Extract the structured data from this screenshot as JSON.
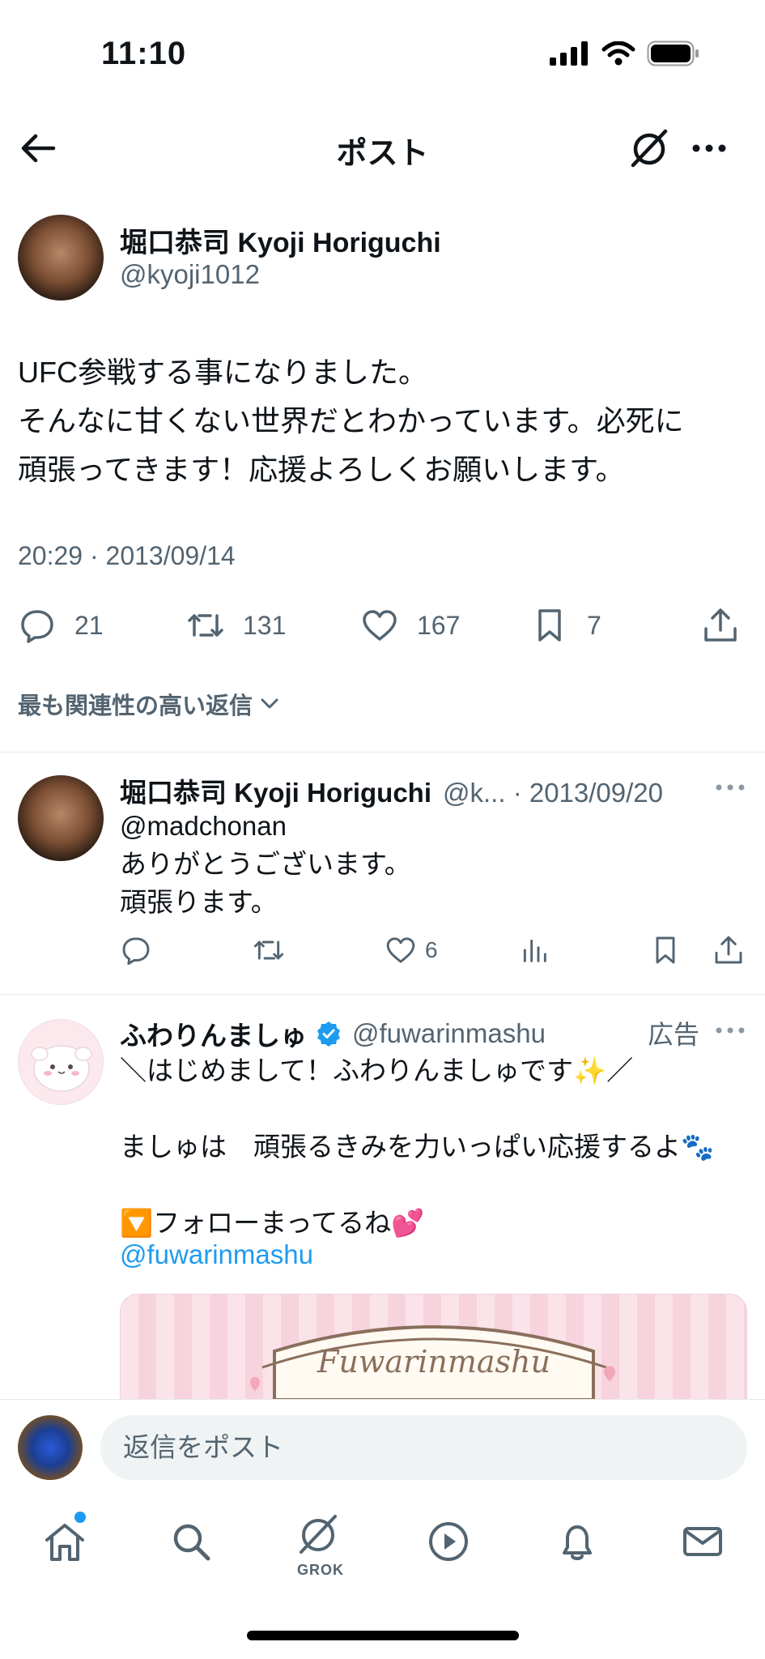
{
  "status_bar": {
    "time": "11:10"
  },
  "header": {
    "title": "ポスト"
  },
  "post": {
    "author_name": "堀口恭司 Kyoji Horiguchi",
    "author_handle": "@kyoji1012",
    "text": "UFC参戦する事になりました。\nそんなに甘くない世界だとわかっています。必死に\n頑張ってきます！応援よろしくお願いします。",
    "timestamp": "20:29 · 2013/09/14",
    "stats": {
      "replies": "21",
      "reposts": "131",
      "likes": "167",
      "bookmarks": "7"
    }
  },
  "replies_filter": {
    "label": "最も関連性の高い返信"
  },
  "reply": {
    "author_name": "堀口恭司 Kyoji Horiguchi",
    "meta": "@k... · 2013/09/20",
    "text": "@madchonan\nありがとうございます。\n頑張ります。",
    "likes": "6"
  },
  "ad": {
    "author_name": "ふわりんましゅ",
    "author_handle": "@fuwarinmashu",
    "label": "広告",
    "text": "＼はじめまして！ふわりんましゅです✨／\n\nましゅは　頑張るきみを力いっぱい応援するよ🐾\n\n🔽フォローまってるね💕",
    "link": "@fuwarinmashu",
    "media_text": "Fuwarinmashu"
  },
  "compose": {
    "placeholder": "返信をポスト"
  },
  "tab_bar": {
    "grok_label": "GROK"
  },
  "colors": {
    "accent": "#1d9bf0",
    "text": "#0f1419",
    "secondary": "#536471",
    "border": "#e7e9ea"
  }
}
